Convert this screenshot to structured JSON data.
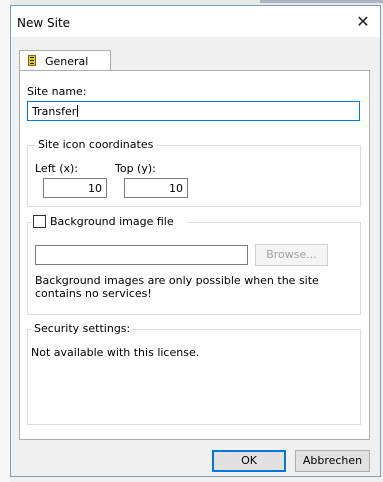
{
  "dialog": {
    "title": "New Site",
    "close_symbol": "✕"
  },
  "tabs": [
    {
      "label": "General",
      "icon": "site-icon"
    }
  ],
  "site_name": {
    "label": "Site name:",
    "value": "Transfer"
  },
  "icon_coordinates": {
    "legend": "Site icon coordinates",
    "left_label": "Left (x):",
    "left_value": "10",
    "top_label": "Top (y):",
    "top_value": "10"
  },
  "background": {
    "checkbox_label": "Background image file",
    "checked": false,
    "path_value": "",
    "browse_label": "Browse...",
    "note": "Background images are only possible when the site contains no services!"
  },
  "security": {
    "legend": "Security settings:",
    "text": "Not available with this license."
  },
  "footer": {
    "ok_label": "OK",
    "cancel_label": "Abbrechen"
  }
}
